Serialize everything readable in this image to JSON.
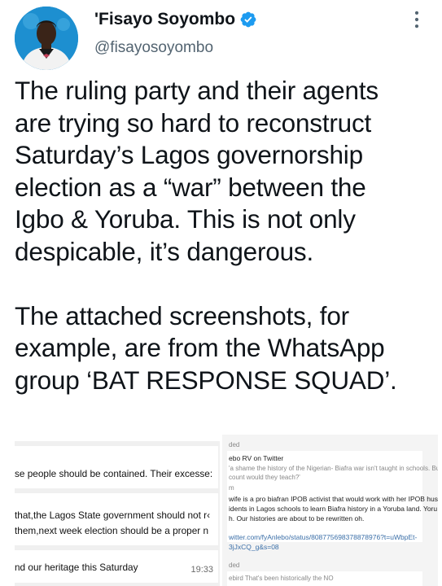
{
  "author": {
    "name": "'Fisayo Soyombo",
    "handle": "@fisayosoyombo"
  },
  "icons": {
    "verified": "verified-badge-icon",
    "more": "more-options-icon",
    "avatar": "profile-photo"
  },
  "colors": {
    "verified_blue": "#1d9bf0",
    "text": "#0f1419",
    "secondary_text": "#536471"
  },
  "tweet": {
    "paragraph1_lines": [
      "The ruling party and their agents",
      "are trying so hard to reconstruct",
      "Saturday’s Lagos governorship",
      "election as a “war” between the",
      "Igbo & Yoruba. This is not only",
      "despicable, it’s dangerous."
    ],
    "paragraph2_lines": [
      "The attached screenshots, for",
      "example, are from the WhatsApp",
      "group ‘BAT RESPONSE SQUAD’."
    ]
  },
  "media": {
    "left_screenshot": {
      "message1": "se people should be contained. Their excesse:",
      "message2_line1": "that,the Lagos State government should not r‹",
      "message2_line2": "them,next week election should be a proper n",
      "message3": "nd our heritage this Saturday",
      "message3_time": "19:33"
    },
    "right_screenshot": {
      "label_top": "ded",
      "sender": "ebo RV on Twitter",
      "quote_line1": "'a shame the history of the Nigerian- Biafra war isn't taught in schools. But to",
      "quote_line2": "count would they teach?'",
      "small_m": "m",
      "body_line1": "wife is a pro biafran IPOB activist that would work with her IPOB hus",
      "body_line2": "idents in Lagos schools to learn Biafra history in a Yoruba land. Yoru",
      "body_line3": "h. Our histories are about to be rewritten oh.",
      "link_line1": "witter.com/fyAnlebo/status/808775698378878976?t=uWbpEt-",
      "link_line2": "3jJxCQ_g&s=08",
      "label_bottom": "ded",
      "footer_line": "ebird That's been historically the NO"
    }
  }
}
